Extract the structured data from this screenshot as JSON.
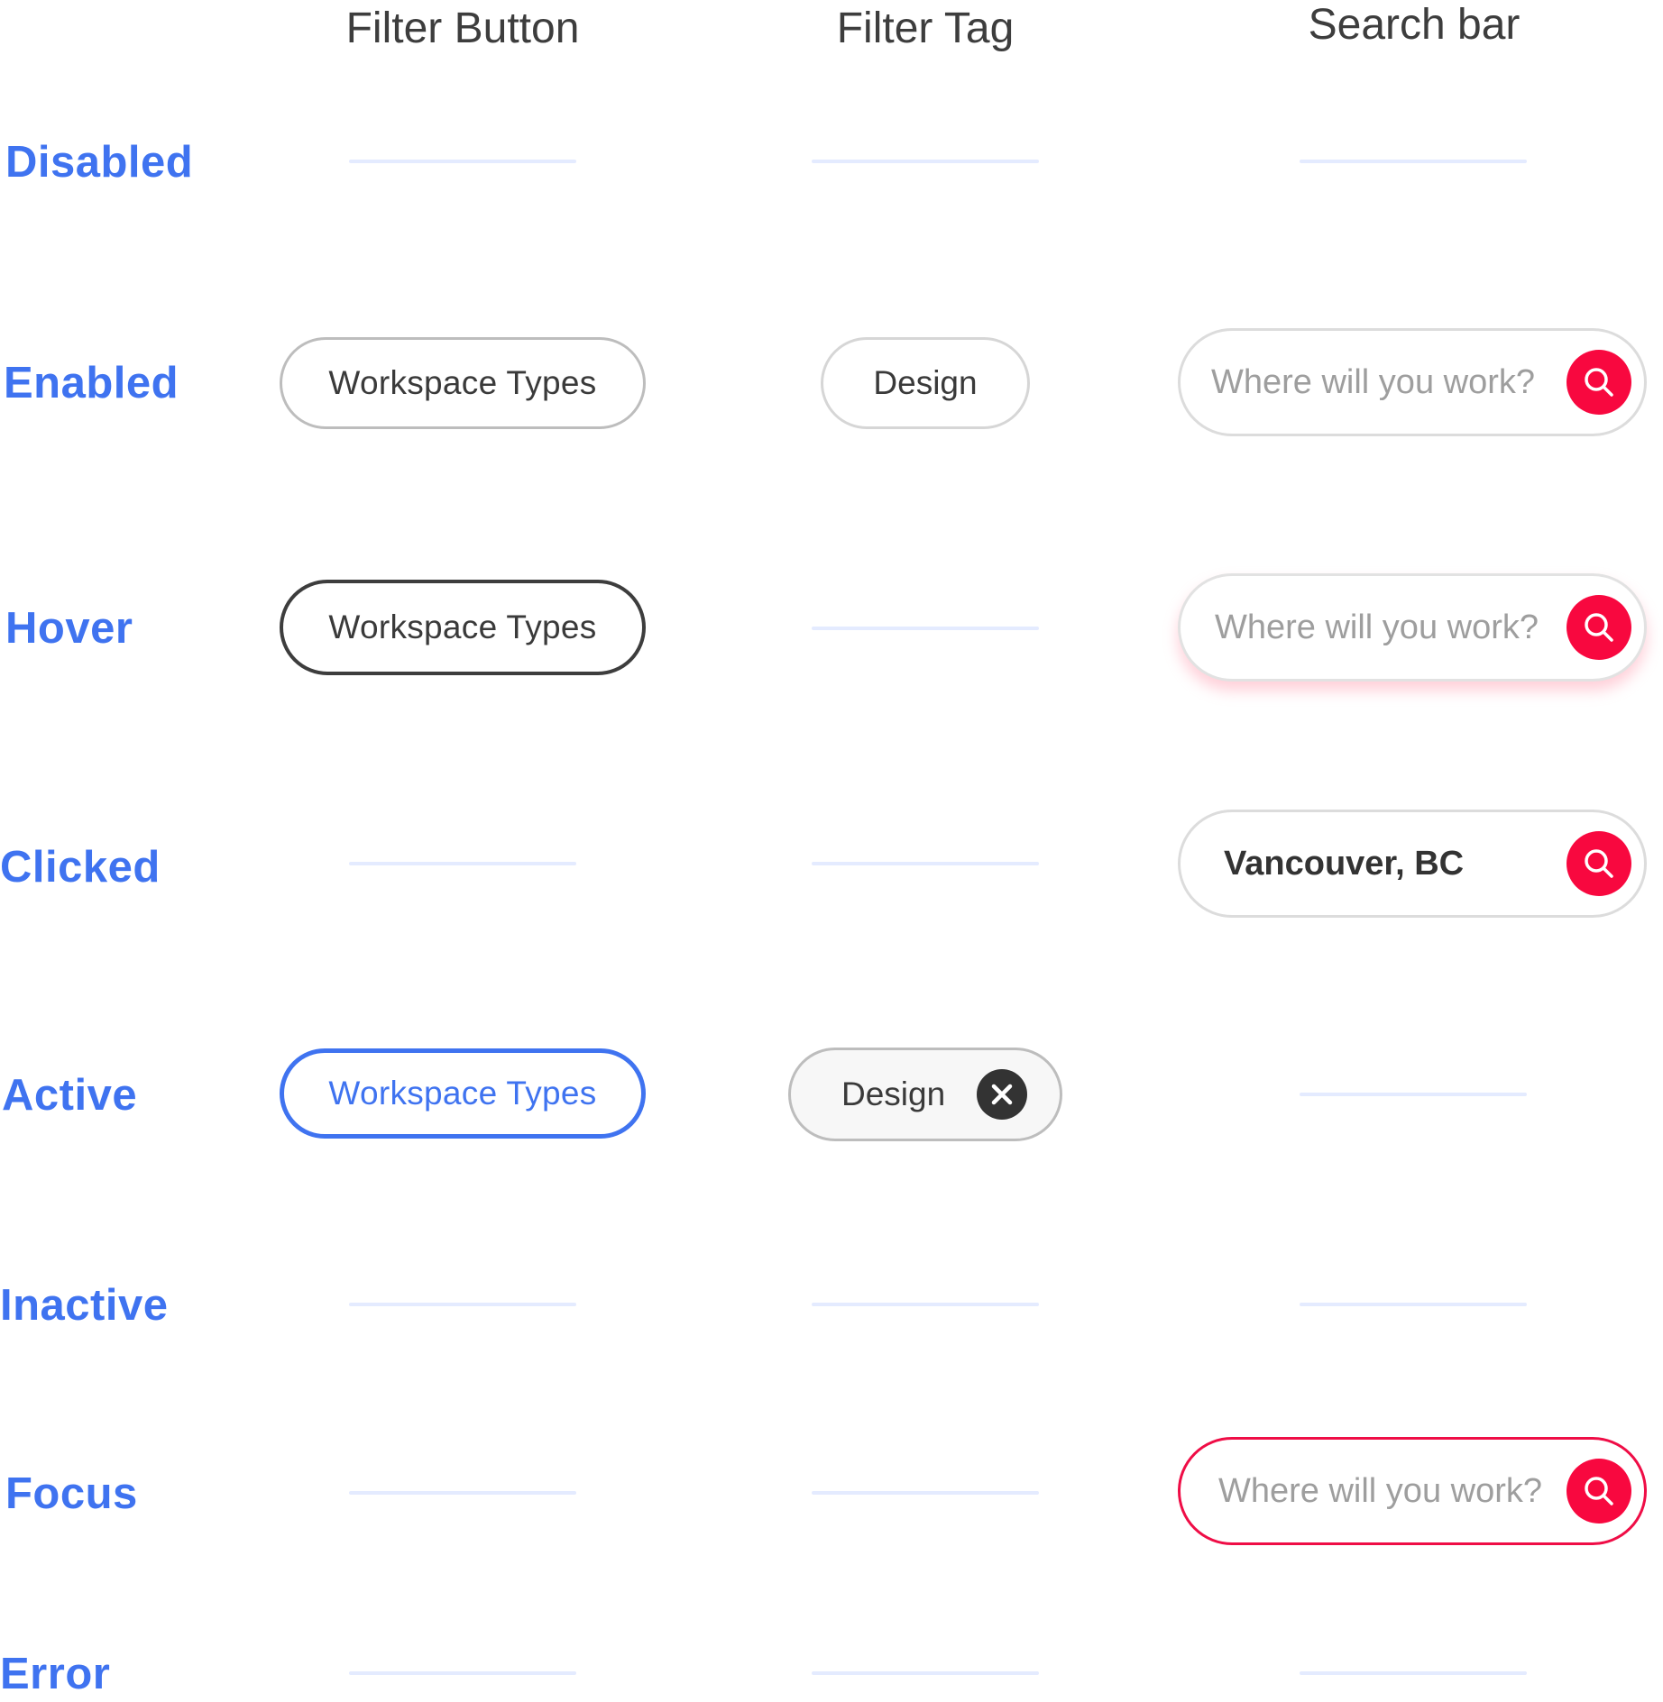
{
  "columns": {
    "filter_button": "Filter Button",
    "filter_tag": "Filter Tag",
    "search_bar": "Search bar"
  },
  "states": {
    "disabled": "Disabled",
    "enabled": "Enabled",
    "hover": "Hover",
    "clicked": "Clicked",
    "active": "Active",
    "inactive": "Inactive",
    "focus": "Focus",
    "error": "Error"
  },
  "filter_button": {
    "enabled_label": "Workspace Types",
    "hover_label": "Workspace Types",
    "active_label": "Workspace Types"
  },
  "filter_tag": {
    "enabled_label": "Design",
    "active_label": "Design"
  },
  "search_bar": {
    "enabled_placeholder": "Where will you work?",
    "hover_placeholder": "Where will you work?",
    "clicked_value": "Vancouver, BC",
    "focus_placeholder": "Where will you work?"
  },
  "icons": {
    "search": "search-icon",
    "close": "close-icon"
  },
  "colors": {
    "state_label": "#3f73f0",
    "active_blue": "#3f73f0",
    "search_red": "#f8083f",
    "focus_border": "#ef0d46",
    "placeholder_line": "#e4ebff"
  }
}
